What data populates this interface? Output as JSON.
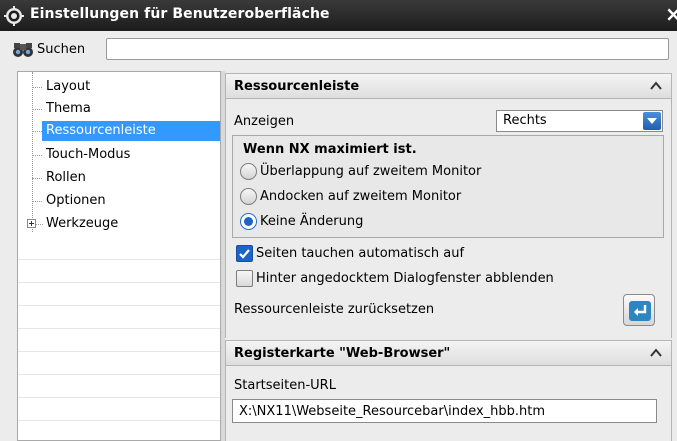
{
  "window": {
    "title": "Einstellungen für Benutzeroberfläche",
    "close_glyph": "×"
  },
  "search": {
    "label": "Suchen",
    "value": ""
  },
  "tree": {
    "items": [
      {
        "label": "Layout"
      },
      {
        "label": "Thema"
      },
      {
        "label": "Ressourcenleiste",
        "selected": true
      },
      {
        "label": "Touch-Modus"
      },
      {
        "label": "Rollen"
      },
      {
        "label": "Optionen"
      },
      {
        "label": "Werkzeuge",
        "expandable": true
      }
    ]
  },
  "ressourcenleiste": {
    "header": "Ressourcenleiste",
    "anzeigen_label": "Anzeigen",
    "anzeigen_value": "Rechts",
    "group_title": "Wenn NX maximiert ist.",
    "radios": [
      {
        "label": "Überlappung auf zweitem Monitor",
        "checked": false
      },
      {
        "label": "Andocken auf zweitem Monitor",
        "checked": false
      },
      {
        "label": "Keine Änderung",
        "checked": true
      }
    ],
    "checkboxes": [
      {
        "label": "Seiten tauchen automatisch auf",
        "checked": true
      },
      {
        "label": "Hinter angedocktem Dialogfenster abblenden",
        "checked": false
      }
    ],
    "reset_label": "Ressourcenleiste zurücksetzen"
  },
  "webbrowser": {
    "header": "Registerkarte \"Web-Browser\"",
    "url_label": "Startseiten-URL",
    "url_value": "X:\\NX11\\Webseite_Resourcebar\\index_hbb.htm"
  },
  "colors": {
    "selection": "#3399ff",
    "accent_blue": "#1e64c8",
    "titlebar": "#2a2a2a"
  }
}
